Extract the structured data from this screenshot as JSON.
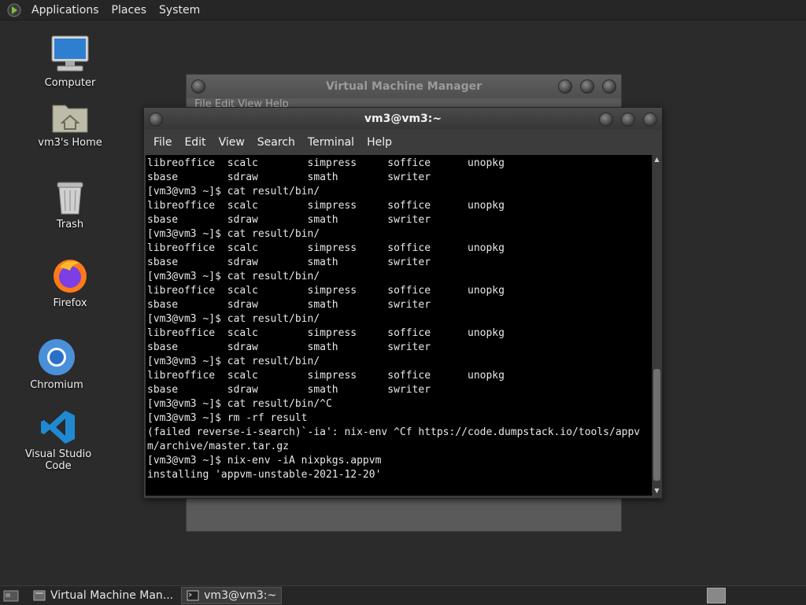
{
  "top_panel": {
    "menus": [
      "Applications",
      "Places",
      "System"
    ]
  },
  "desktop": {
    "icons": [
      {
        "label": "Computer",
        "icon": "computer-icon"
      },
      {
        "label": "vm3's Home",
        "icon": "home-folder-icon"
      },
      {
        "label": "Trash",
        "icon": "trash-icon"
      },
      {
        "label": "Firefox",
        "icon": "firefox-icon"
      },
      {
        "label": "Chromium",
        "icon": "chromium-icon"
      },
      {
        "label": "Visual Studio Code",
        "icon": "vscode-icon"
      }
    ]
  },
  "vmm_window": {
    "title": "Virtual Machine Manager",
    "menubar": "File   Edit   View   Help"
  },
  "terminal": {
    "title": "vm3@vm3:~",
    "menus": [
      "File",
      "Edit",
      "View",
      "Search",
      "Terminal",
      "Help"
    ],
    "lines": [
      "libreoffice  scalc        simpress     soffice      unopkg",
      "sbase        sdraw        smath        swriter",
      "[vm3@vm3 ~]$ cat result/bin/",
      "libreoffice  scalc        simpress     soffice      unopkg",
      "sbase        sdraw        smath        swriter",
      "[vm3@vm3 ~]$ cat result/bin/",
      "libreoffice  scalc        simpress     soffice      unopkg",
      "sbase        sdraw        smath        swriter",
      "[vm3@vm3 ~]$ cat result/bin/",
      "libreoffice  scalc        simpress     soffice      unopkg",
      "sbase        sdraw        smath        swriter",
      "[vm3@vm3 ~]$ cat result/bin/",
      "libreoffice  scalc        simpress     soffice      unopkg",
      "sbase        sdraw        smath        swriter",
      "[vm3@vm3 ~]$ cat result/bin/",
      "libreoffice  scalc        simpress     soffice      unopkg",
      "sbase        sdraw        smath        swriter",
      "[vm3@vm3 ~]$ cat result/bin/^C",
      "[vm3@vm3 ~]$ rm -rf result",
      "(failed reverse-i-search)`-ia': nix-env ^Cf https://code.dumpstack.io/tools/appv",
      "m/archive/master.tar.gz",
      "[vm3@vm3 ~]$ nix-env -iA nixpkgs.appvm",
      "installing 'appvm-unstable-2021-12-20'"
    ]
  },
  "taskbar": {
    "tasks": [
      {
        "label": "Virtual Machine Man...",
        "icon": "vmm-task-icon",
        "active": false
      },
      {
        "label": "vm3@vm3:~",
        "icon": "terminal-task-icon",
        "active": true
      }
    ]
  }
}
